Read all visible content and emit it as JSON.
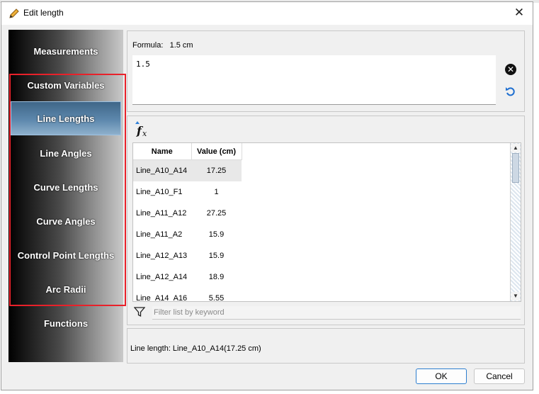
{
  "window": {
    "title": "Edit length"
  },
  "sidebar": {
    "items": [
      {
        "label": "Measurements"
      },
      {
        "label": "Custom Variables"
      },
      {
        "label": "Line Lengths"
      },
      {
        "label": "Line Angles"
      },
      {
        "label": "Curve Lengths"
      },
      {
        "label": "Curve Angles"
      },
      {
        "label": "Control Point Lengths"
      },
      {
        "label": "Arc Radii"
      },
      {
        "label": "Functions"
      }
    ],
    "active": "Line Lengths"
  },
  "formula": {
    "label": "Formula:",
    "result": "1.5 cm",
    "value": "1.5"
  },
  "table": {
    "headers": [
      "Name",
      "Value (cm)"
    ],
    "rows": [
      {
        "name": "Line_A10_A14",
        "value": "17.25"
      },
      {
        "name": "Line_A10_F1",
        "value": "1"
      },
      {
        "name": "Line_A11_A12",
        "value": "27.25"
      },
      {
        "name": "Line_A11_A2",
        "value": "15.9"
      },
      {
        "name": "Line_A12_A13",
        "value": "15.9"
      },
      {
        "name": "Line_A12_A14",
        "value": "18.9"
      },
      {
        "name": "Line_A14_A16",
        "value": "5.55"
      }
    ]
  },
  "filter": {
    "placeholder": "Filter list by keyword"
  },
  "status": {
    "text": "Line length: Line_A10_A14(17.25 cm)"
  },
  "buttons": {
    "ok": "OK",
    "cancel": "Cancel"
  },
  "colors": {
    "highlight": "#e8212a",
    "active_item": "#5d88ad",
    "ok_border": "#2d7ecf"
  }
}
